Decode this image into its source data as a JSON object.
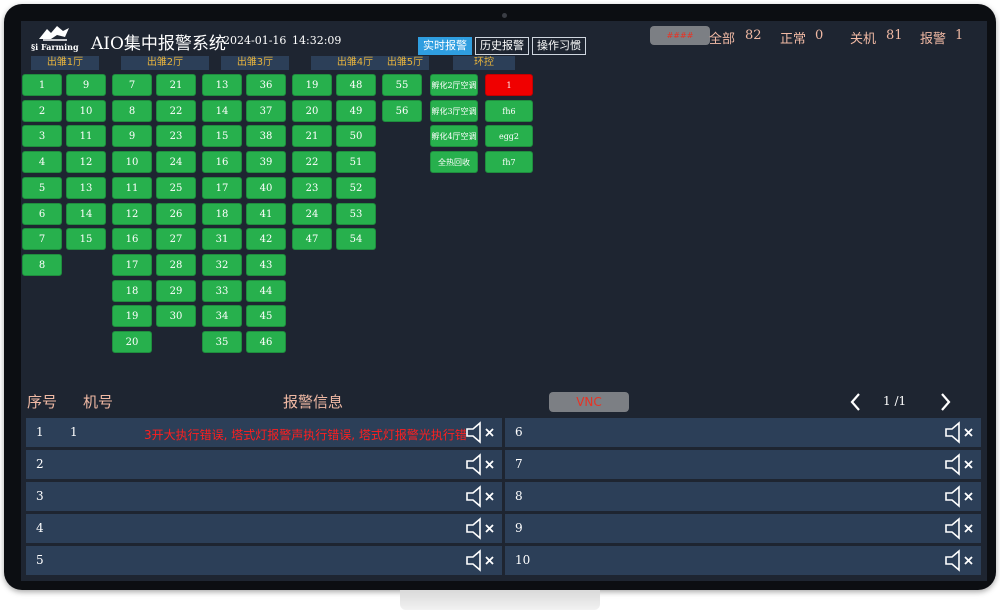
{
  "header": {
    "logo_text": "§i Farming",
    "app_title": "AIO集中报警系统",
    "date": "2024-01-16",
    "time": "14:32:09",
    "tabs": [
      {
        "label": "实时报警",
        "active": true
      },
      {
        "label": "历史报警",
        "active": false
      },
      {
        "label": "操作习惯",
        "active": false
      }
    ],
    "top_pill": "####",
    "stats": {
      "all_label": "全部",
      "all_value": "82",
      "normal_label": "正常",
      "normal_value": "0",
      "off_label": "关机",
      "off_value": "81",
      "alarm_label": "报警",
      "alarm_value": "1"
    }
  },
  "sections": [
    {
      "title": "出雏1厅",
      "col1": [
        "1",
        "2",
        "3",
        "4",
        "5",
        "6",
        "7",
        "8"
      ],
      "col2": [
        "9",
        "10",
        "11",
        "12",
        "13",
        "14",
        "15"
      ]
    },
    {
      "title": "出雏2厅",
      "col1": [
        "7",
        "8",
        "9",
        "10",
        "11",
        "12",
        "16",
        "17",
        "18",
        "19",
        "20"
      ],
      "col2": [
        "21",
        "22",
        "23",
        "24",
        "25",
        "26",
        "27",
        "28",
        "29",
        "30"
      ]
    },
    {
      "title": "出雏3厅",
      "col1": [
        "13",
        "14",
        "15",
        "16",
        "17",
        "18",
        "31",
        "32",
        "33",
        "34",
        "35"
      ],
      "col2": [
        "36",
        "37",
        "38",
        "39",
        "40",
        "41",
        "42",
        "43",
        "44",
        "45",
        "46"
      ]
    },
    {
      "title": "出雏4厅",
      "col1": [
        "19",
        "20",
        "21",
        "22",
        "23",
        "24",
        "47"
      ],
      "col2": [
        "48",
        "49",
        "50",
        "51",
        "52",
        "53",
        "54"
      ]
    },
    {
      "title": "出雏5厅",
      "col1": [
        "55",
        "56"
      ],
      "col2": []
    }
  ],
  "env": {
    "title": "环控",
    "col1": [
      "孵化2厅空调",
      "孵化3厅空调",
      "孵化4厅空调",
      "全热回收"
    ],
    "col2": [
      {
        "label": "1",
        "status": "alarm"
      },
      {
        "label": "fh6",
        "status": "normal"
      },
      {
        "label": "egg2",
        "status": "normal"
      },
      {
        "label": "fh7",
        "status": "normal"
      }
    ]
  },
  "alarm_list": {
    "col_index": "序号",
    "col_machine": "机号",
    "col_message": "报警信息",
    "vnc_label": "VNC",
    "page_text": "1  /1",
    "rows": [
      {
        "num": "1",
        "machine": "1",
        "message": "3开大执行错误, 塔式灯报警声执行错误, 塔式灯报警光执行错"
      },
      {
        "num": "2",
        "machine": "",
        "message": ""
      },
      {
        "num": "3",
        "machine": "",
        "message": ""
      },
      {
        "num": "4",
        "machine": "",
        "message": ""
      },
      {
        "num": "5",
        "machine": "",
        "message": ""
      },
      {
        "num": "6",
        "machine": "",
        "message": ""
      },
      {
        "num": "7",
        "machine": "",
        "message": ""
      },
      {
        "num": "8",
        "machine": "",
        "message": ""
      },
      {
        "num": "9",
        "machine": "",
        "message": ""
      },
      {
        "num": "10",
        "machine": "",
        "message": ""
      }
    ]
  },
  "colors": {
    "screen_bg": "#1e2531",
    "ok_green": "#27b04d",
    "alarm_red": "#f00000",
    "accent_blue": "#2f9ee0",
    "label_salmon": "#f0b9a4",
    "section_gold": "#e8b43c"
  }
}
